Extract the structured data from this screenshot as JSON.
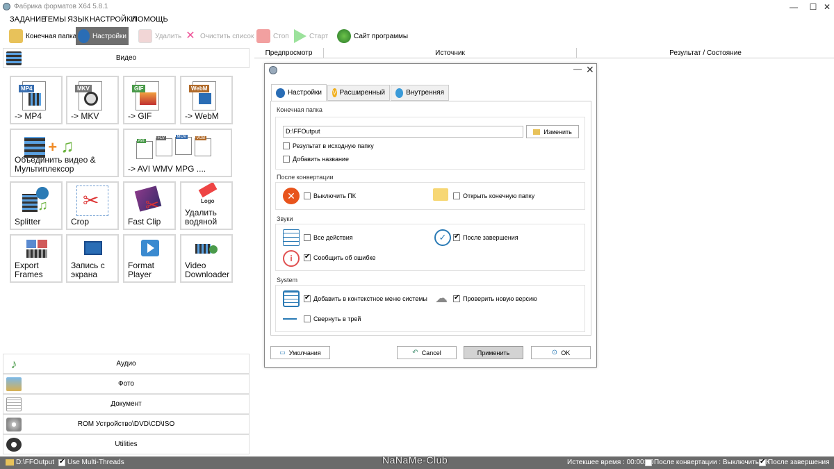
{
  "window": {
    "title": "Фабрика форматов X64 5.8.1"
  },
  "menu": [
    "ЗАДАНИЕ",
    "ТЕМЫ",
    "ЯЗЫК",
    "НАСТРОЙКИ",
    "ПОМОЩЬ"
  ],
  "toolbar": {
    "output_folder": "Конечная папка",
    "settings": "Настройки",
    "delete": "Удалить",
    "clear_list": "Очистить список",
    "stop": "Стоп",
    "start": "Старт",
    "website": "Сайт программы"
  },
  "left": {
    "video_header": "Видео",
    "tiles": [
      {
        "label": "-> MP4",
        "format": "MP4"
      },
      {
        "label": "-> MKV",
        "format": "MKV"
      },
      {
        "label": "-> GIF",
        "format": "GIF"
      },
      {
        "label": "-> WebM",
        "format": "WebM"
      },
      {
        "label": "Объединить видео &\nМультиплексор"
      },
      {
        "label": "-> AVI WMV MPG ....",
        "formats": [
          "AVI",
          "FLV",
          "MOV",
          "VOB"
        ]
      },
      {
        "label": "Splitter"
      },
      {
        "label": "Crop"
      },
      {
        "label": "Fast Clip"
      },
      {
        "label": "Удалить\nводяной",
        "logo": "Logo"
      },
      {
        "label": "Export\nFrames"
      },
      {
        "label": "Запись с\nэкрана"
      },
      {
        "label": "Format\nPlayer"
      },
      {
        "label": "Video\nDownloader"
      }
    ],
    "categories": [
      "Аудио",
      "Фото",
      "Документ",
      "ROM Устройство\\DVD\\CD\\ISO",
      "Utilities"
    ]
  },
  "table": {
    "columns": [
      "Предпросмотр",
      "Источник",
      "Результат / Состояние"
    ]
  },
  "dialog": {
    "tabs": [
      "Настройки",
      "Расширенный",
      "Внутренняя"
    ],
    "sec_output": "Конечная папка",
    "output_path": "D:\\FFOutput",
    "change_btn": "Изменить",
    "result_in_source": "Результат в исходную папку",
    "add_name": "Добавить название",
    "sec_after": "После конвертации",
    "shutdown_pc": "Выключить ПК",
    "open_folder": "Открыть конечную папку",
    "sec_sounds": "Звуки",
    "all_actions": "Все действия",
    "after_finish": "После завершения",
    "report_error": "Сообщить об ошибке",
    "sec_system": "System",
    "add_context_menu": "Добавить в контекстное меню системы",
    "check_new_version": "Проверить новую версию",
    "minimize_tray": "Свернуть в трей",
    "defaults_btn": "Умолчания",
    "cancel_btn": "Cancel",
    "apply_btn": "Применить",
    "ok_btn": "OK",
    "checks": {
      "result_in_source": false,
      "add_name": false,
      "shutdown_pc": false,
      "open_folder": false,
      "all_actions": false,
      "after_finish": true,
      "report_error": true,
      "add_context_menu": true,
      "check_new_version": true,
      "minimize_tray": false
    }
  },
  "status": {
    "path": "D:\\FFOutput",
    "multithreads": "Use Multi-Threads",
    "elapsed": "Истекшее время : 00:00:00",
    "after_conv": "После конвертации : Выключить ПК",
    "after_finish": "После завершения"
  },
  "watermark": "NaNaMe-Club",
  "colors": {
    "accent": "#0078d7",
    "toolbar_active": "#6e6e6e",
    "status_bg": "#6b6b6b",
    "error": "#e8541c"
  }
}
